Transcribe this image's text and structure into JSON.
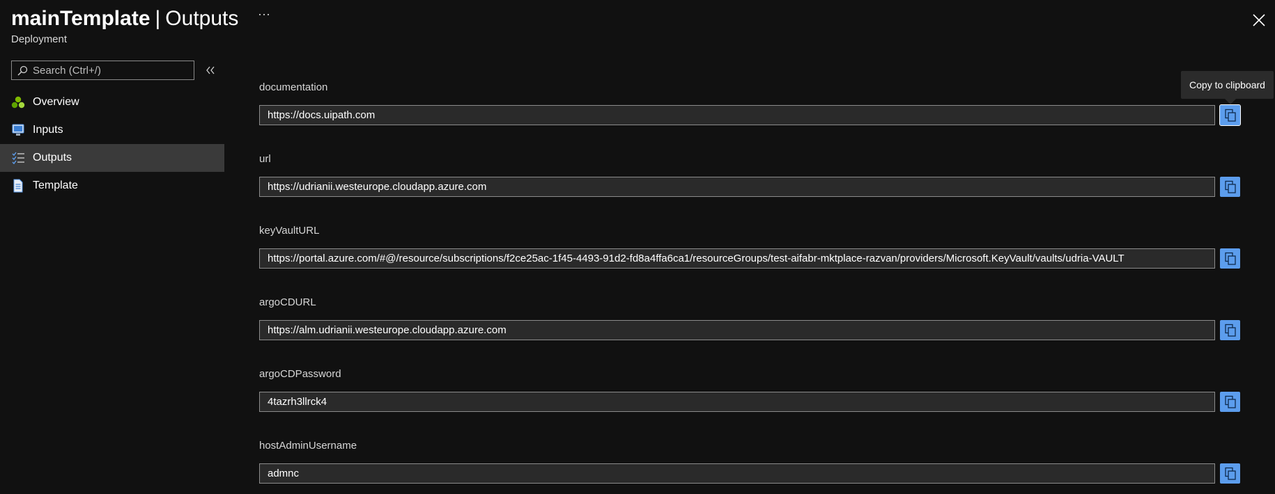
{
  "header": {
    "title": "mainTemplate",
    "separator": "|",
    "page": "Outputs",
    "subtitle": "Deployment",
    "more_label": "···"
  },
  "sidebar": {
    "search_placeholder": "Search (Ctrl+/)",
    "items": [
      {
        "label": "Overview",
        "icon": "overview-icon",
        "active": false
      },
      {
        "label": "Inputs",
        "icon": "inputs-icon",
        "active": false
      },
      {
        "label": "Outputs",
        "icon": "outputs-icon",
        "active": true
      },
      {
        "label": "Template",
        "icon": "template-icon",
        "active": false
      }
    ]
  },
  "outputs": [
    {
      "label": "documentation",
      "value": "https://docs.uipath.com"
    },
    {
      "label": "url",
      "value": "https://udrianii.westeurope.cloudapp.azure.com"
    },
    {
      "label": "keyVaultURL",
      "value": "https://portal.azure.com/#@/resource/subscriptions/f2ce25ac-1f45-4493-91d2-fd8a4ffa6ca1/resourceGroups/test-aifabr-mktplace-razvan/providers/Microsoft.KeyVault/vaults/udria-VAULT"
    },
    {
      "label": "argoCDURL",
      "value": "https://alm.udrianii.westeurope.cloudapp.azure.com"
    },
    {
      "label": "argoCDPassword",
      "value": "4tazrh3llrck4"
    },
    {
      "label": "hostAdminUsername",
      "value": "admnc"
    }
  ],
  "tooltip": {
    "text": "Copy to clipboard"
  },
  "colors": {
    "background": "#111111",
    "active_nav": "#3a3a3a",
    "accent": "#5c9ded",
    "field_bg": "#2a2a2a"
  }
}
